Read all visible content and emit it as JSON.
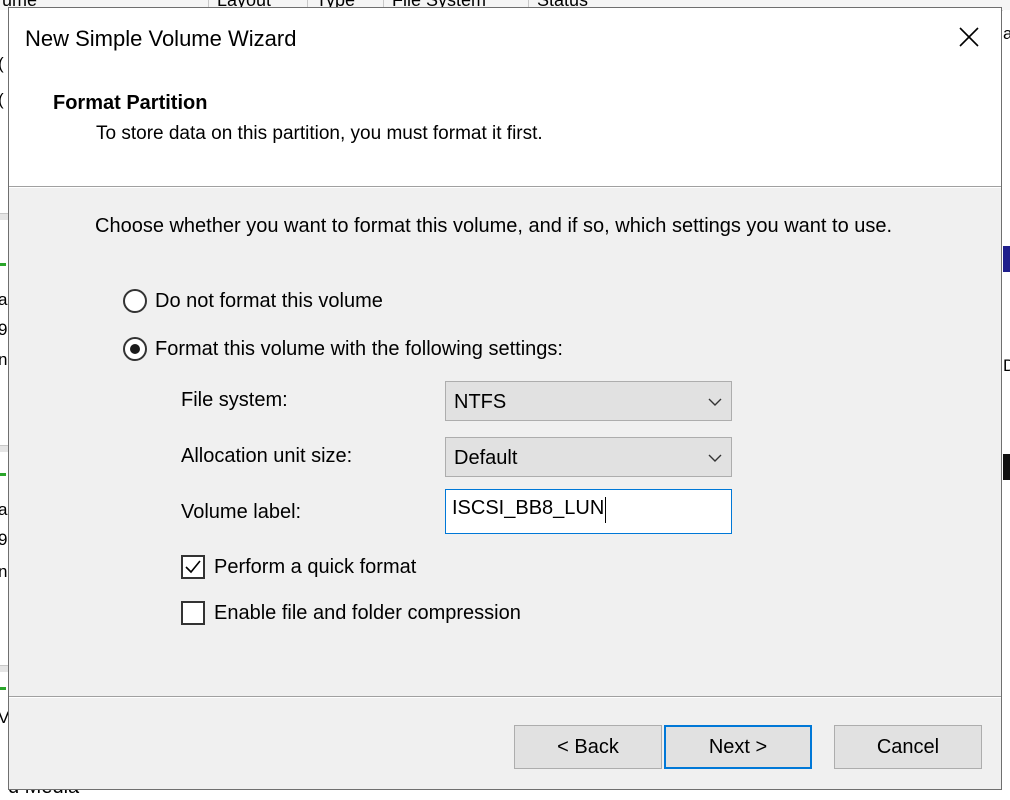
{
  "background_app": {
    "columns": [
      "ume",
      "Layout",
      "Type",
      "File System",
      "Status"
    ],
    "left_fragments": [
      "(",
      "(",
      "as",
      "9.",
      "n",
      "as",
      "9.",
      "n",
      "V"
    ],
    "right_fragments": [
      "a",
      "D"
    ],
    "bottom_fragment": "d Media"
  },
  "dialog": {
    "title": "New Simple Volume Wizard",
    "close_label": "Close",
    "header": {
      "title": "Format Partition",
      "subtitle": "To store data on this partition, you must format it first."
    },
    "intro": "Choose whether you want to format this volume, and if so, which settings you want to use.",
    "options": {
      "no_format": {
        "label": "Do not format this volume",
        "selected": false
      },
      "format": {
        "label": "Format this volume with the following settings:",
        "selected": true
      }
    },
    "settings": {
      "file_system": {
        "label": "File system:",
        "value": "NTFS"
      },
      "allocation_unit_size": {
        "label": "Allocation unit size:",
        "value": "Default"
      },
      "volume_label": {
        "label": "Volume label:",
        "value": "ISCSI_BB8_LUN"
      }
    },
    "checkboxes": {
      "quick_format": {
        "label": "Perform a quick format",
        "checked": true
      },
      "compression": {
        "label": "Enable file and folder compression",
        "checked": false
      }
    },
    "buttons": {
      "back": "< Back",
      "next": "Next >",
      "cancel": "Cancel"
    },
    "colors": {
      "accent": "#0078d7",
      "dialog_bg": "#f0f0f0",
      "header_bg": "#ffffff",
      "button_bg": "#e1e1e1"
    }
  }
}
